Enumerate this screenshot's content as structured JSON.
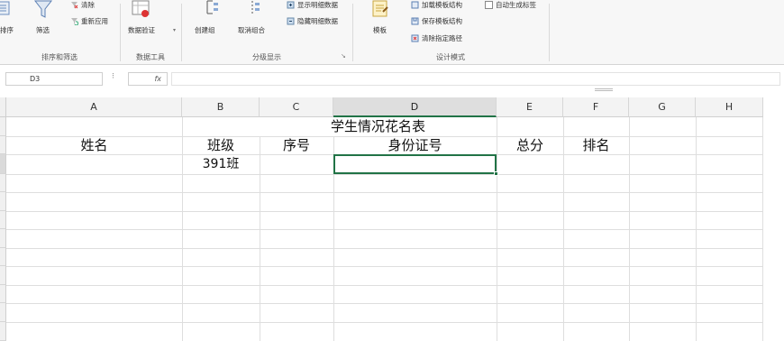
{
  "ribbon": {
    "sort_filter": {
      "sort_label": "排序",
      "filter_label": "筛选",
      "clear_label": "清除",
      "reapply_label": "重新应用",
      "group_label": "排序和筛选"
    },
    "data_tools": {
      "validation_label": "数据验证",
      "group_label": "数据工具"
    },
    "outline": {
      "group_btn_label": "创建组",
      "ungroup_btn_label": "取消组合",
      "show_detail_label": "显示明细数据",
      "hide_detail_label": "隐藏明细数据",
      "group_label": "分级显示"
    },
    "design": {
      "template_label": "模板",
      "load_label": "加载模板结构",
      "save_label": "保存模板结构",
      "clear_label": "清除指定路径",
      "auto_label": "自动生成标签",
      "group_label": "设计模式"
    }
  },
  "formula_bar": {
    "name_box": "D3",
    "dots": "⁝",
    "fx": "fx",
    "value": ""
  },
  "columns": [
    "A",
    "B",
    "C",
    "D",
    "E",
    "F",
    "G",
    "H"
  ],
  "selected_column": "D",
  "cells": {
    "title": "学生情况花名表",
    "name_header": "姓名",
    "class_header": "班级",
    "seq_header": "序号",
    "id_header": "身份证号",
    "total_header": "总分",
    "rank_header": "排名",
    "class_value": "391班"
  },
  "colors": {
    "selection": "#217346",
    "header_bg": "#f3f3f3",
    "gridline": "#dedede"
  }
}
